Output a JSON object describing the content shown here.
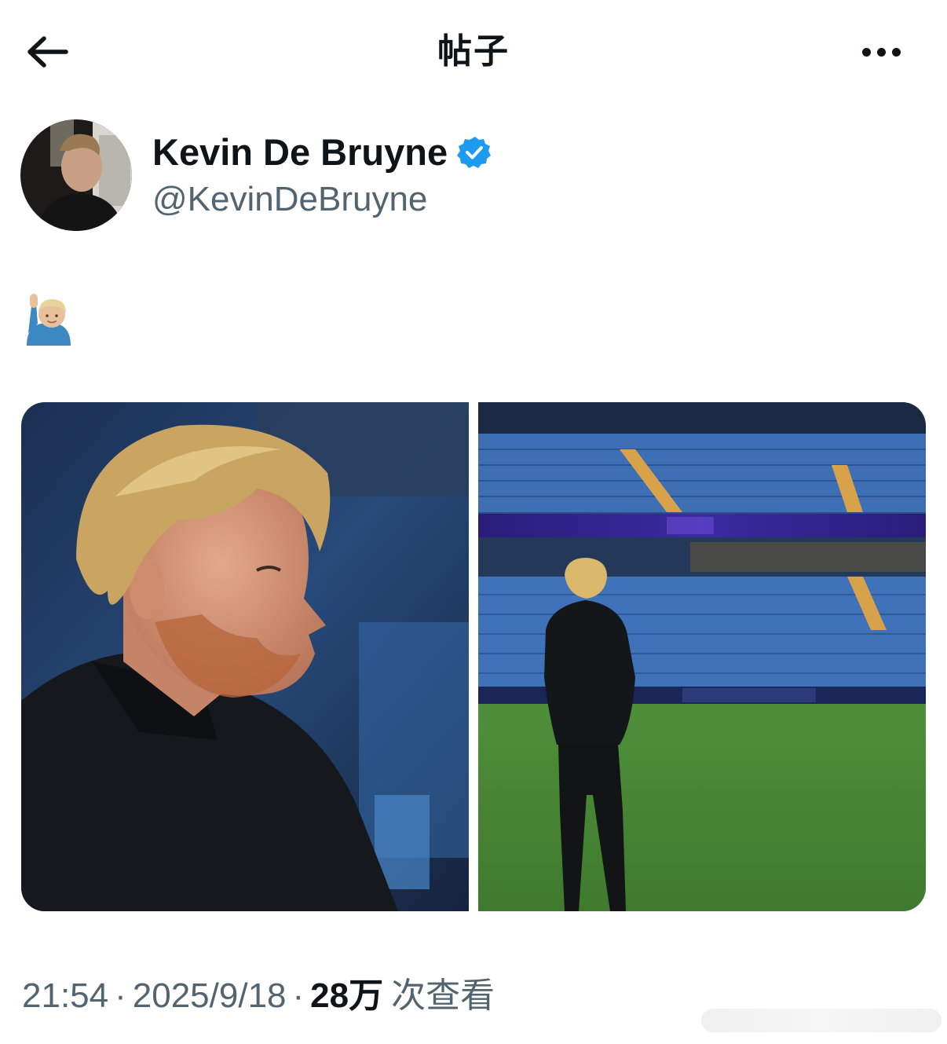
{
  "header": {
    "title": "帖子",
    "back_icon": "arrow-left-icon",
    "more_icon": "more-horizontal-icon"
  },
  "author": {
    "name": "Kevin De Bruyne",
    "handle": "@KevinDeBruyne",
    "verified": true,
    "verified_color": "#1d9bf0"
  },
  "post": {
    "text": "🙋🏼‍♂️",
    "media": [
      {
        "kind": "photo",
        "subject": "portrait-in-stadium-tunnel"
      },
      {
        "kind": "photo",
        "subject": "standing-on-pitch-empty-stadium"
      }
    ]
  },
  "meta": {
    "time": "21:54",
    "separator": "·",
    "date": "2025/9/18",
    "views_count": "28万",
    "views_label": "次查看"
  },
  "colors": {
    "text_primary": "#0f1419",
    "text_secondary": "#536471",
    "accent": "#1d9bf0"
  }
}
